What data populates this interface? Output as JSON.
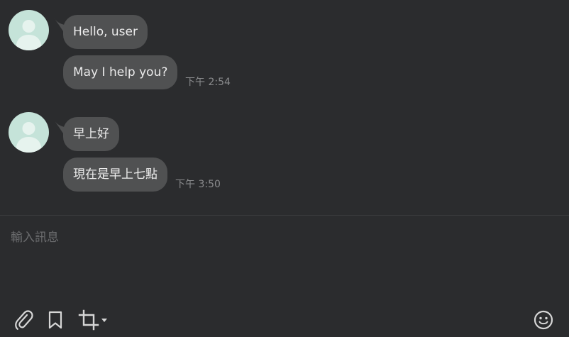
{
  "messages": [
    {
      "text": "Hello, user",
      "time": ""
    },
    {
      "text": "May I help you?",
      "time": "下午 2:54"
    },
    {
      "text": "早上好",
      "time": ""
    },
    {
      "text": "現在是早上七點",
      "time": "下午 3:50"
    }
  ],
  "composer": {
    "placeholder": "輸入訊息"
  },
  "toolbar": {
    "icons": [
      "paperclip-icon",
      "bookmark-icon",
      "crop-icon",
      "caret-down-icon",
      "emoji-icon"
    ]
  },
  "colors": {
    "background": "#2b2c2e",
    "bubble": "#505152",
    "avatar": "#c5e3d9",
    "timestamp": "#8a8b8d",
    "icon": "#d6d6d6"
  }
}
